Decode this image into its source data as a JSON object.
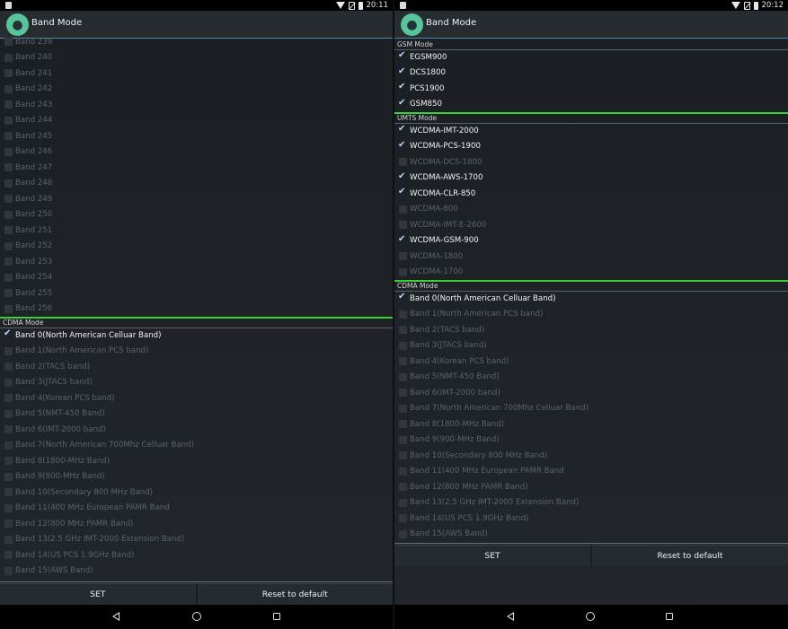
{
  "left": {
    "status_time": "20:11",
    "title": "Band Mode",
    "lte_tail": [
      {
        "label": "Band 239",
        "checked": false
      },
      {
        "label": "Band 240",
        "checked": false
      },
      {
        "label": "Band 241",
        "checked": false
      },
      {
        "label": "Band 242",
        "checked": false
      },
      {
        "label": "Band 243",
        "checked": false
      },
      {
        "label": "Band 244",
        "checked": false
      },
      {
        "label": "Band 245",
        "checked": false
      },
      {
        "label": "Band 246",
        "checked": false
      },
      {
        "label": "Band 247",
        "checked": false
      },
      {
        "label": "Band 248",
        "checked": false
      },
      {
        "label": "Band 249",
        "checked": false
      },
      {
        "label": "Band 250",
        "checked": false
      },
      {
        "label": "Band 251",
        "checked": false
      },
      {
        "label": "Band 252",
        "checked": false
      },
      {
        "label": "Band 253",
        "checked": false
      },
      {
        "label": "Band 254",
        "checked": false
      },
      {
        "label": "Band 255",
        "checked": false
      },
      {
        "label": "Band 256",
        "checked": false
      }
    ],
    "cdma_header": "CDMA Mode",
    "cdma": [
      {
        "label": "Band 0(North American Celluar Band)",
        "checked": true
      },
      {
        "label": "Band 1(North American PCS band)",
        "checked": false
      },
      {
        "label": "Band 2(TACS band)",
        "checked": false
      },
      {
        "label": "Band 3(JTACS band)",
        "checked": false
      },
      {
        "label": "Band 4(Korean PCS band)",
        "checked": false
      },
      {
        "label": "Band 5(NMT-450 Band)",
        "checked": false
      },
      {
        "label": "Band 6(IMT-2000 band)",
        "checked": false
      },
      {
        "label": "Band 7(North American 700Mhz Celluar Band)",
        "checked": false
      },
      {
        "label": "Band 8(1800-MHz Band)",
        "checked": false
      },
      {
        "label": "Band 9(900-MHz Band)",
        "checked": false
      },
      {
        "label": "Band 10(Secondary 800 MHz Band)",
        "checked": false
      },
      {
        "label": "Band 11(400 MHz European PAMR Band",
        "checked": false
      },
      {
        "label": "Band 12(800 MHz PAMR Band)",
        "checked": false
      },
      {
        "label": "Band 13(2.5 GHz IMT-2000 Extension Band)",
        "checked": false
      },
      {
        "label": "Band 14(US PCS 1.9GHz Band)",
        "checked": false
      },
      {
        "label": "Band 15(AWS Band)",
        "checked": false
      }
    ],
    "set_label": "SET",
    "reset_label": "Reset to default"
  },
  "right": {
    "status_time": "20:12",
    "title": "Band Mode",
    "gsm_header": "GSM Mode",
    "gsm": [
      {
        "label": "EGSM900",
        "checked": true
      },
      {
        "label": "DCS1800",
        "checked": true
      },
      {
        "label": "PCS1900",
        "checked": true
      },
      {
        "label": "GSM850",
        "checked": true
      }
    ],
    "umts_header": "UMTS Mode",
    "umts": [
      {
        "label": "WCDMA-IMT-2000",
        "checked": true
      },
      {
        "label": "WCDMA-PCS-1900",
        "checked": true
      },
      {
        "label": "WCDMA-DCS-1800",
        "checked": false
      },
      {
        "label": "WCDMA-AWS-1700",
        "checked": true
      },
      {
        "label": "WCDMA-CLR-850",
        "checked": true
      },
      {
        "label": "WCDMA-800",
        "checked": false
      },
      {
        "label": "WCDMA-IMT-E-2600",
        "checked": false
      },
      {
        "label": "WCDMA-GSM-900",
        "checked": true
      },
      {
        "label": "WCDMA-1800",
        "checked": false
      },
      {
        "label": "WCDMA-1700",
        "checked": false
      }
    ],
    "cdma_header": "CDMA Mode",
    "cdma": [
      {
        "label": "Band 0(North American Celluar Band)",
        "checked": true
      },
      {
        "label": "Band 1(North American PCS band)",
        "checked": false
      },
      {
        "label": "Band 2(TACS band)",
        "checked": false
      },
      {
        "label": "Band 3(JTACS band)",
        "checked": false
      },
      {
        "label": "Band 4(Korean PCS band)",
        "checked": false
      },
      {
        "label": "Band 5(NMT-450 Band)",
        "checked": false
      },
      {
        "label": "Band 6(IMT-2000 band)",
        "checked": false
      },
      {
        "label": "Band 7(North American 700Mhz Celluar Band)",
        "checked": false
      },
      {
        "label": "Band 8(1800-MHz Band)",
        "checked": false
      },
      {
        "label": "Band 9(900-MHz Band)",
        "checked": false
      },
      {
        "label": "Band 10(Secondary 800 MHz Band)",
        "checked": false
      },
      {
        "label": "Band 11(400 MHz European PAMR Band",
        "checked": false
      },
      {
        "label": "Band 12(800 MHz PAMR Band)",
        "checked": false
      },
      {
        "label": "Band 13(2.5 GHz IMT-2000 Extension Band)",
        "checked": false
      },
      {
        "label": "Band 14(US PCS 1.9GHz Band)",
        "checked": false
      },
      {
        "label": "Band 15(AWS Band)",
        "checked": false
      }
    ],
    "set_label": "SET",
    "reset_label": "Reset to default"
  },
  "icons": {
    "notification": "notification-icon",
    "wifi": "wifi-icon",
    "sim": "no-sim-icon",
    "battery": "battery-icon",
    "app": "android-app-icon",
    "back": "back-icon",
    "home": "home-icon",
    "recents": "recents-icon"
  },
  "colors": {
    "section_divider": "#3ad23a",
    "appbar_line": "#4a87a6",
    "checkmark": "#b9d7ff"
  }
}
